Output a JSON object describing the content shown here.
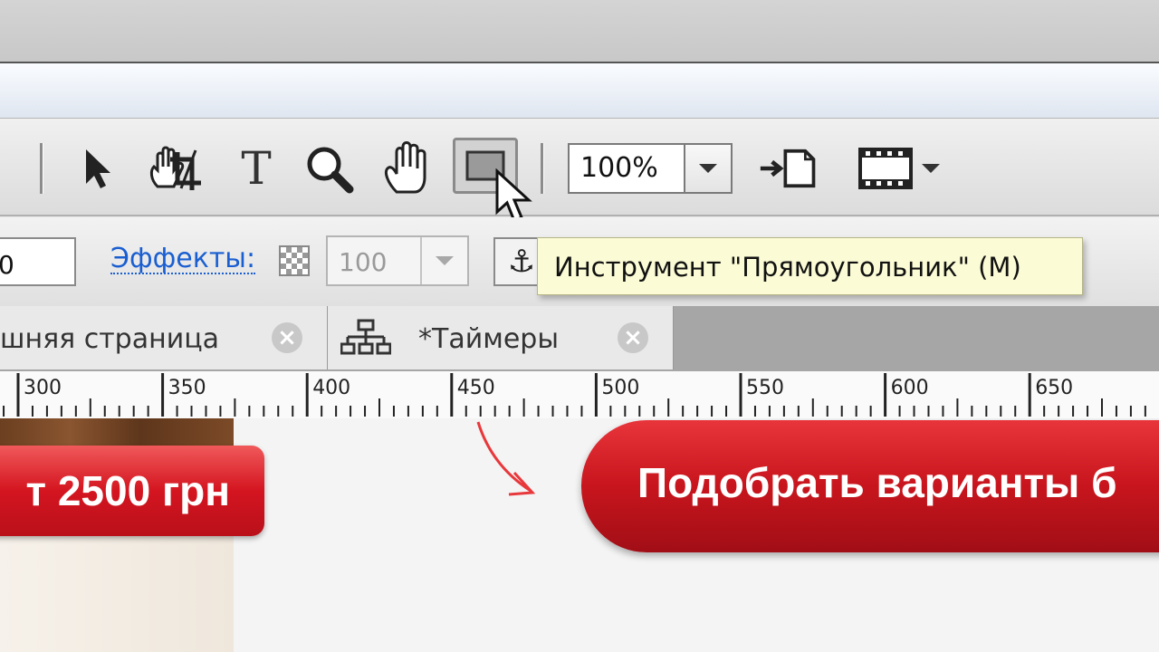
{
  "toolbar": {
    "zoom_value": "100%",
    "icons": [
      "pointer-icon",
      "crop-icon",
      "text-icon",
      "zoom-icon",
      "hand-icon",
      "rectangle-icon",
      "export-icon",
      "preview-icon"
    ]
  },
  "options": {
    "field_value": "0",
    "effects_label": "Эффекты:",
    "opacity_value": "100"
  },
  "tooltip": "Инструмент \"Прямоугольник\" (M)",
  "tabs": [
    {
      "label": "шняя страница"
    },
    {
      "label": "*Таймеры"
    }
  ],
  "ruler": {
    "labels": [
      "300",
      "350",
      "400",
      "450",
      "500",
      "550",
      "600",
      "650"
    ]
  },
  "canvas": {
    "button_left_text": "т 2500 грн",
    "button_right_text": "Подобрать варианты б"
  },
  "colors": {
    "accent_red": "#d41520",
    "link_blue": "#1a5fd1",
    "tooltip_bg": "#fbfbd6"
  }
}
